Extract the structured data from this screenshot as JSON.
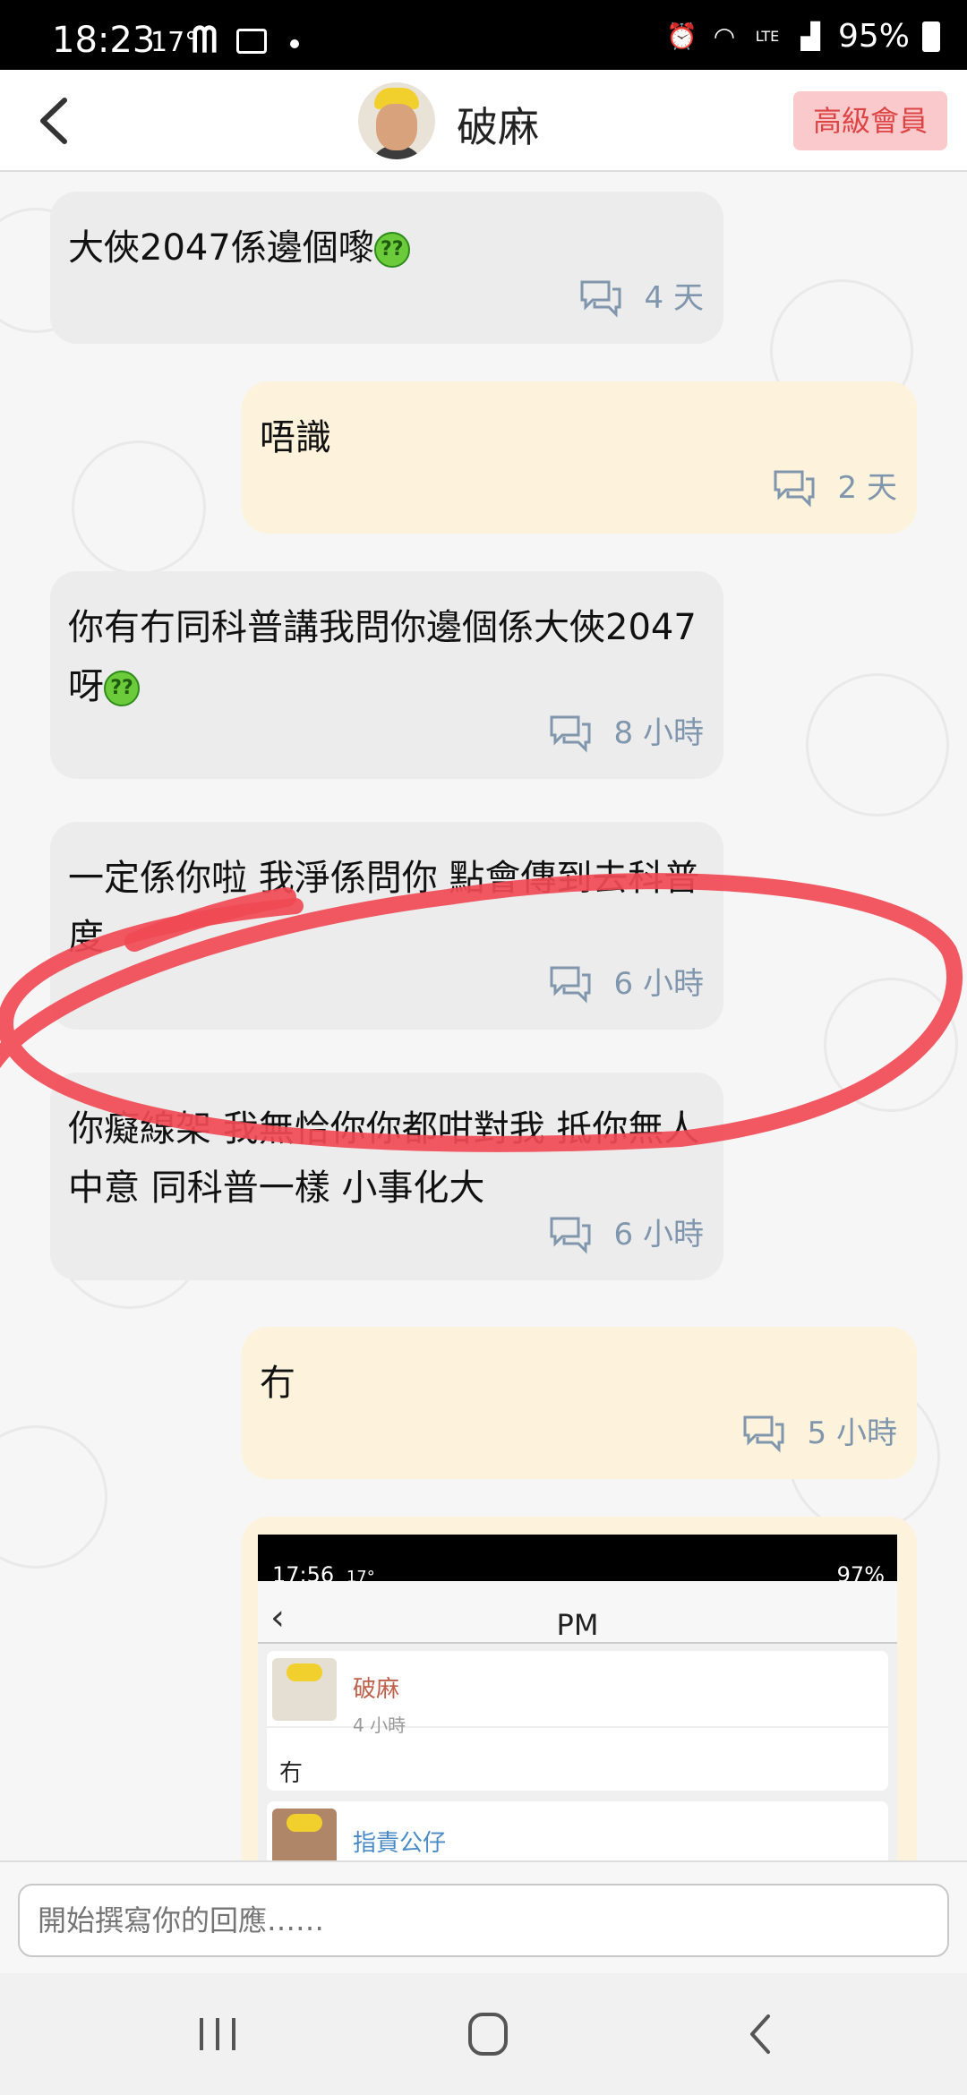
{
  "status_bar": {
    "time": "18:23",
    "temperature": "17°",
    "battery": "95%",
    "icons": [
      "mcdonalds-icon",
      "image-icon",
      "alarm-icon",
      "wifi-icon",
      "volte-icon",
      "signal-icon",
      "battery-icon"
    ]
  },
  "header": {
    "title": "破麻",
    "badge": "高級會員"
  },
  "messages": [
    {
      "direction": "in",
      "text": "大俠2047係邊個嚟",
      "emoji": "??",
      "time": "4 天"
    },
    {
      "direction": "out",
      "text": "唔識",
      "time": "2 天"
    },
    {
      "direction": "in",
      "text": "你有冇同科普講我問你邊個係大俠2047呀",
      "emoji": "??",
      "time": "8 小時"
    },
    {
      "direction": "in",
      "text": "一定係你啦 我淨係問你 點會傳到去科普度",
      "time": "6 小時"
    },
    {
      "direction": "in",
      "text": "你癡線架 我無恰你你都咁對我 抵你無人中意 同科普一樣 小事化大",
      "time": "6 小時"
    },
    {
      "direction": "out",
      "text": "冇",
      "time": "5 小時"
    }
  ],
  "embedded_screenshot": {
    "time": "17:56",
    "temperature": "17°",
    "battery": "97%",
    "title": "PM",
    "card1_name": "破麻",
    "card1_time": "4 小時",
    "card1_text": "冇",
    "card2_name": "指責公仔"
  },
  "reply_input": {
    "placeholder": "開始撰寫你的回應……"
  },
  "colors": {
    "incoming_bubble": "#ececec",
    "outgoing_bubble": "#fdf3dc",
    "vip_badge_bg": "#f9c9cc",
    "vip_badge_text": "#dd4444",
    "meta_text": "#7f96ad",
    "annotation": "#f04a55"
  }
}
